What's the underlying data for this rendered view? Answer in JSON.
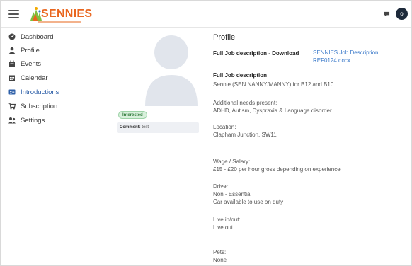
{
  "header": {
    "logo_text": "SENNIES",
    "avatar_initial": "o"
  },
  "sidebar": {
    "items": [
      {
        "label": "Dashboard",
        "icon": "dashboard-icon"
      },
      {
        "label": "Profile",
        "icon": "user-icon"
      },
      {
        "label": "Events",
        "icon": "events-icon"
      },
      {
        "label": "Calendar",
        "icon": "calendar-icon"
      },
      {
        "label": "Introductions",
        "icon": "introductions-icon",
        "active": true
      },
      {
        "label": "Subscription",
        "icon": "cart-icon"
      },
      {
        "label": "Settings",
        "icon": "settings-icon"
      }
    ]
  },
  "card": {
    "status": "Interested",
    "comment_label": "Comment:",
    "comment_value": "test"
  },
  "profile": {
    "title": "Profile",
    "download_label": "Full Job description - Download",
    "download_link_line1": "SENNIES Job Description",
    "download_link_line2": "REF0124.docx",
    "job_desc_label": "Full Job description",
    "job_desc_value": "Sennie (SEN NANNY/MANNY) for B12 and B10",
    "needs_label": "Additional needs present:",
    "needs_value": "ADHD, Autism, Dyspraxia & Language disorder",
    "location_label": "Location:",
    "location_value": "Clapham Junction, SW11",
    "wage_label": "Wage / Salary:",
    "wage_value": "£15 - £20 per hour gross depending on experience",
    "driver_label": "Driver:",
    "driver_value1": "Non - Essential",
    "driver_value2": "Car available to use on duty",
    "live_label": "Live in/out:",
    "live_value": "Live out",
    "pets_label": "Pets:",
    "pets_value": "None"
  },
  "colors": {
    "accent": "#2d5fa8",
    "link": "#3a79c9",
    "brand_orange": "#e9661f",
    "badge_green_bg": "#d8f0dc",
    "badge_green_text": "#2f7a3a"
  }
}
